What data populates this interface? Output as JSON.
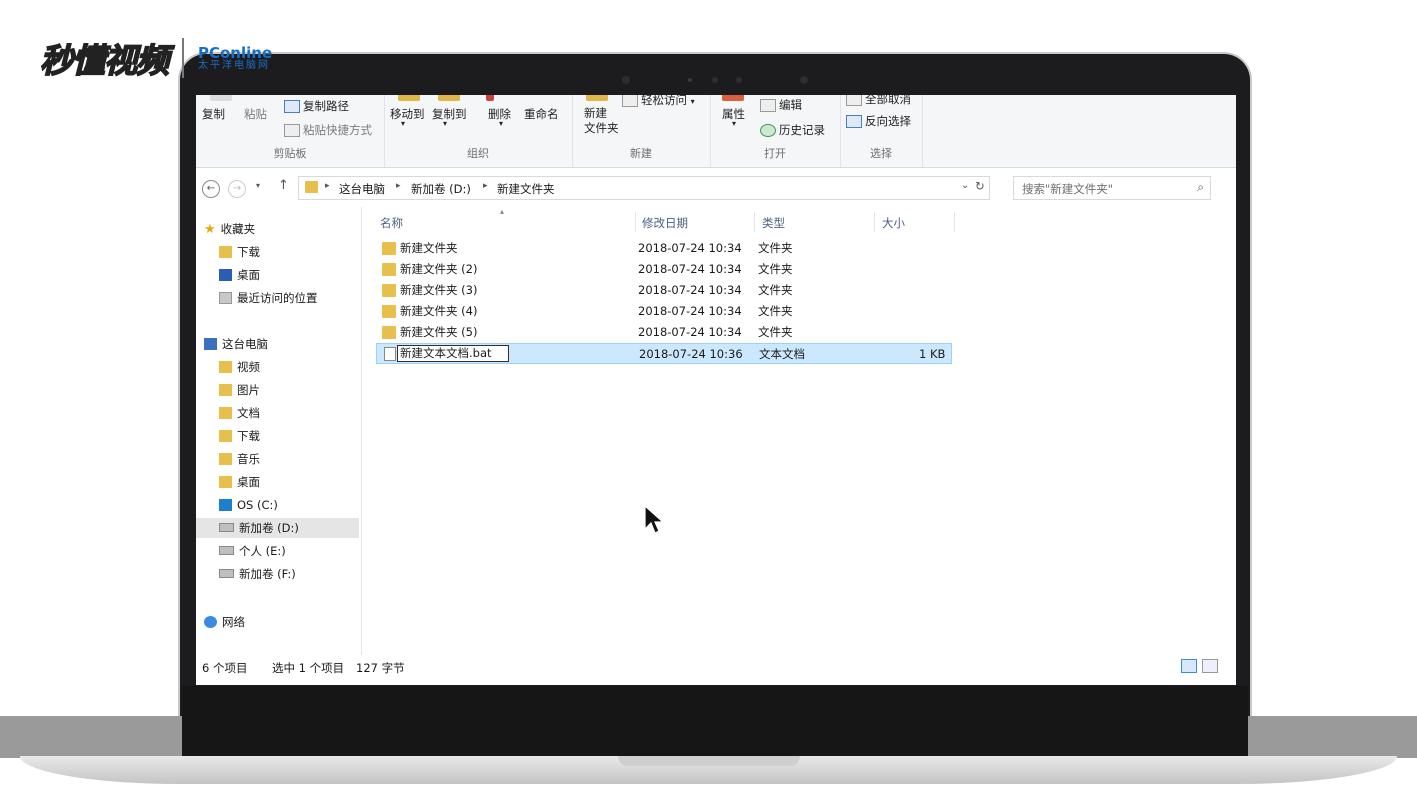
{
  "watermark": {
    "brand": "秒懂视频",
    "partner": "PConline",
    "partner_sub": "太平洋电脑网"
  },
  "ribbon": {
    "clipboard": {
      "copy": "复制",
      "paste": "粘贴",
      "copy_path": "复制路径",
      "paste_shortcut": "粘贴快捷方式",
      "label": "剪贴板"
    },
    "organize": {
      "move_to": "移动到",
      "copy_to": "复制到",
      "delete": "删除",
      "rename": "重命名",
      "label": "组织"
    },
    "new": {
      "new_folder": "新建\n文件夹",
      "new_folder_line1": "新建",
      "new_folder_line2": "文件夹",
      "easy_access": "轻松访问",
      "label": "新建"
    },
    "open": {
      "properties": "属性",
      "edit": "编辑",
      "history": "历史记录",
      "label": "打开"
    },
    "select": {
      "select_none": "全部取消",
      "invert": "反向选择",
      "label": "选择"
    }
  },
  "address": {
    "crumbs": [
      "这台电脑",
      "新加卷 (D:)",
      "新建文件夹"
    ],
    "search_placeholder": "搜索\"新建文件夹\""
  },
  "nav": {
    "favorites": "收藏夹",
    "fav_items": [
      "下载",
      "桌面",
      "最近访问的位置"
    ],
    "this_pc": "这台电脑",
    "pc_items": [
      "视频",
      "图片",
      "文档",
      "下载",
      "音乐",
      "桌面",
      "OS (C:)",
      "新加卷 (D:)",
      "个人 (E:)",
      "新加卷 (F:)"
    ],
    "network": "网络"
  },
  "columns": {
    "name": "名称",
    "modified": "修改日期",
    "type": "类型",
    "size": "大小"
  },
  "files": [
    {
      "name": "新建文件夹",
      "modified": "2018-07-24 10:34",
      "type": "文件夹",
      "size": ""
    },
    {
      "name": "新建文件夹 (2)",
      "modified": "2018-07-24 10:34",
      "type": "文件夹",
      "size": ""
    },
    {
      "name": "新建文件夹 (3)",
      "modified": "2018-07-24 10:34",
      "type": "文件夹",
      "size": ""
    },
    {
      "name": "新建文件夹 (4)",
      "modified": "2018-07-24 10:34",
      "type": "文件夹",
      "size": ""
    },
    {
      "name": "新建文件夹 (5)",
      "modified": "2018-07-24 10:34",
      "type": "文件夹",
      "size": ""
    },
    {
      "name": "新建文本文档.bat",
      "modified": "2018-07-24 10:36",
      "type": "文本文档",
      "size": "1 KB"
    }
  ],
  "status": {
    "count": "6 个项目",
    "selected": "选中 1 个项目",
    "bytes": "127 字节"
  },
  "colors": {
    "selection": "#cce8ff",
    "selection_border": "#99d1ff",
    "folder": "#e7bf4d",
    "bezel": "#1c1c1e"
  }
}
